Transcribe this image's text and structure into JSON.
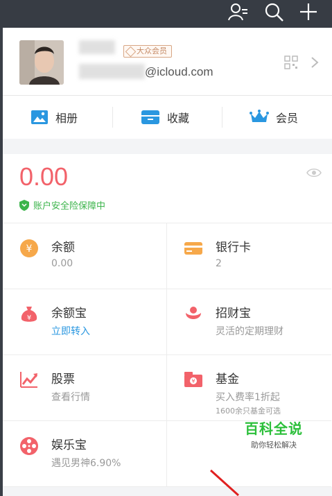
{
  "profile": {
    "vip_label": "大众会员",
    "email": "@icloud.com"
  },
  "quick_links": [
    {
      "label": "相册",
      "icon": "photo-album-icon"
    },
    {
      "label": "收藏",
      "icon": "favorites-icon"
    },
    {
      "label": "会员",
      "icon": "crown-icon"
    }
  ],
  "assets": {
    "balance": "0.00",
    "security": "账户安全险保障中"
  },
  "grid": [
    {
      "title": "余额",
      "sub": "0.00",
      "icon": "yuan-coin-icon"
    },
    {
      "title": "银行卡",
      "sub": "2",
      "icon": "bank-card-icon"
    },
    {
      "title": "余额宝",
      "sub": "立即转入",
      "icon": "money-bag-icon"
    },
    {
      "title": "招财宝",
      "sub": "灵活的定期理财",
      "icon": "zhaocaibao-icon"
    },
    {
      "title": "股票",
      "sub": "查看行情",
      "icon": "stock-chart-icon"
    },
    {
      "title": "基金",
      "sub": "买入费率1折起",
      "sub2": "1600余只基金可选",
      "icon": "fund-icon"
    },
    {
      "title": "娱乐宝",
      "sub": "遇见男神6.90%",
      "icon": "film-reel-icon"
    }
  ],
  "watermark": {
    "title": "百科全说",
    "subtitle": "助你轻松解决"
  },
  "colors": {
    "accent_red": "#f2626a",
    "link_blue": "#2a97e0",
    "safe_green": "#3cb44b"
  }
}
